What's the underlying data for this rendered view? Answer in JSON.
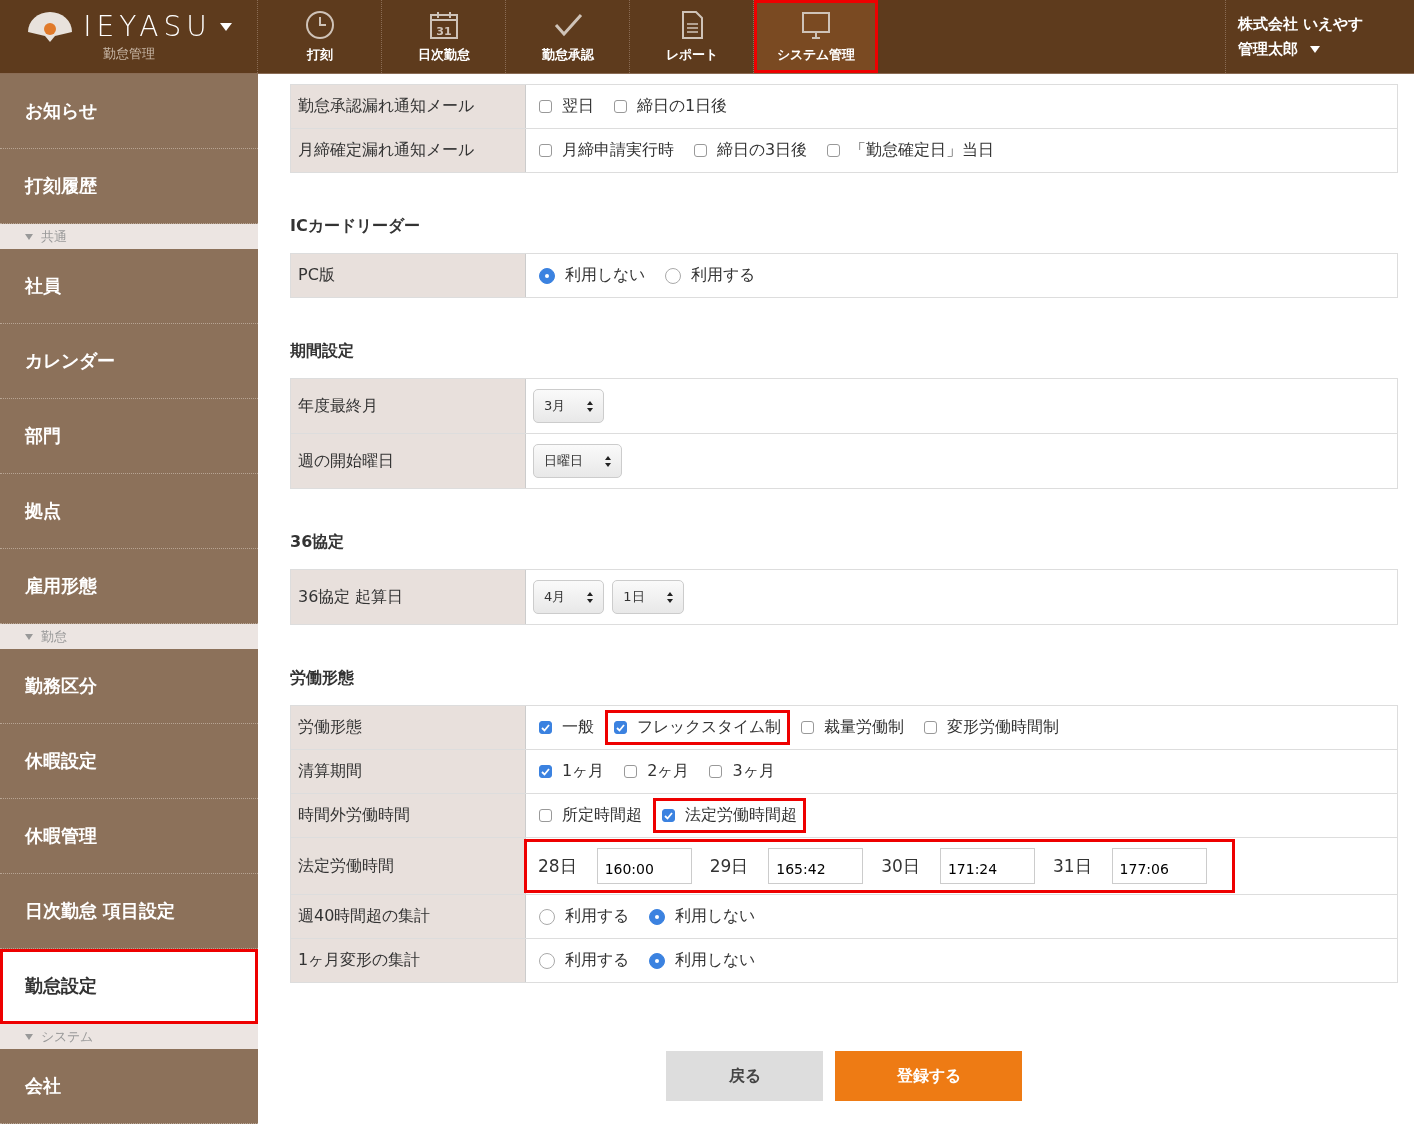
{
  "header": {
    "brand": "IEYASU",
    "subtitle": "勤怠管理",
    "nav": [
      {
        "label": "打刻",
        "kind": "clock",
        "selected": false,
        "highlighted": false
      },
      {
        "label": "日次勤怠",
        "kind": "calendar",
        "icon_text": "31",
        "selected": false,
        "highlighted": false
      },
      {
        "label": "勤怠承認",
        "kind": "check",
        "selected": false,
        "highlighted": false
      },
      {
        "label": "レポート",
        "kind": "document",
        "selected": false,
        "highlighted": false
      },
      {
        "label": "システム管理",
        "kind": "monitor",
        "selected": true,
        "highlighted": true
      }
    ],
    "user": {
      "company": "株式会社 いえやす",
      "name": "管理太郎"
    }
  },
  "sidebar": {
    "items": [
      {
        "kind": "item",
        "label": "お知らせ",
        "selected": false,
        "highlighted": false
      },
      {
        "kind": "item",
        "label": "打刻履歴",
        "selected": false,
        "highlighted": false
      },
      {
        "kind": "section",
        "label": "共通"
      },
      {
        "kind": "item",
        "label": "社員",
        "selected": false,
        "highlighted": false
      },
      {
        "kind": "item",
        "label": "カレンダー",
        "selected": false,
        "highlighted": false
      },
      {
        "kind": "item",
        "label": "部門",
        "selected": false,
        "highlighted": false
      },
      {
        "kind": "item",
        "label": "拠点",
        "selected": false,
        "highlighted": false
      },
      {
        "kind": "item",
        "label": "雇用形態",
        "selected": false,
        "highlighted": false
      },
      {
        "kind": "section",
        "label": "勤怠"
      },
      {
        "kind": "item",
        "label": "勤務区分",
        "selected": false,
        "highlighted": false
      },
      {
        "kind": "item",
        "label": "休暇設定",
        "selected": false,
        "highlighted": false
      },
      {
        "kind": "item",
        "label": "休暇管理",
        "selected": false,
        "highlighted": false
      },
      {
        "kind": "item",
        "label": "日次勤怠 項目設定",
        "selected": false,
        "highlighted": false
      },
      {
        "kind": "item",
        "label": "勤怠設定",
        "selected": true,
        "highlighted": true
      },
      {
        "kind": "section",
        "label": "システム"
      },
      {
        "kind": "item",
        "label": "会社",
        "selected": false,
        "highlighted": false
      }
    ]
  },
  "sections": [
    {
      "rows": [
        {
          "label": "勤怠承認漏れ通知メール",
          "kind": "checkboxes",
          "options": [
            {
              "label": "翌日",
              "checked": false,
              "highlighted": false
            },
            {
              "label": "締日の1日後",
              "checked": false,
              "highlighted": false
            }
          ]
        },
        {
          "label": "月締確定漏れ通知メール",
          "kind": "checkboxes",
          "options": [
            {
              "label": "月締申請実行時",
              "checked": false,
              "highlighted": false
            },
            {
              "label": "締日の3日後",
              "checked": false,
              "highlighted": false
            },
            {
              "label": "「勤怠確定日」当日",
              "checked": false,
              "highlighted": false
            }
          ]
        }
      ]
    },
    {
      "title": "ICカードリーダー",
      "rows": [
        {
          "label": "PC版",
          "kind": "radios",
          "options": [
            {
              "label": "利用しない",
              "selected": true
            },
            {
              "label": "利用する",
              "selected": false
            }
          ]
        }
      ]
    },
    {
      "title": "期間設定",
      "rows": [
        {
          "label": "年度最終月",
          "kind": "selects",
          "selects": [
            "3月"
          ]
        },
        {
          "label": "週の開始曜日",
          "kind": "selects",
          "selects": [
            "日曜日"
          ]
        }
      ]
    },
    {
      "title": "36協定",
      "rows": [
        {
          "label": "36協定 起算日",
          "kind": "selects",
          "selects": [
            "4月",
            "1日"
          ]
        }
      ]
    },
    {
      "title": "労働形態",
      "rows": [
        {
          "label": "労働形態",
          "kind": "checkboxes",
          "options": [
            {
              "label": "一般",
              "checked": true,
              "highlighted": false
            },
            {
              "label": "フレックスタイム制",
              "checked": true,
              "highlighted": true
            },
            {
              "label": "裁量労働制",
              "checked": false,
              "highlighted": false
            },
            {
              "label": "変形労働時間制",
              "checked": false,
              "highlighted": false
            }
          ]
        },
        {
          "label": "清算期間",
          "kind": "checkboxes",
          "options": [
            {
              "label": "1ヶ月",
              "checked": true,
              "highlighted": false
            },
            {
              "label": "2ヶ月",
              "checked": false,
              "highlighted": false
            },
            {
              "label": "3ヶ月",
              "checked": false,
              "highlighted": false
            }
          ]
        },
        {
          "label": "時間外労働時間",
          "kind": "checkboxes",
          "options": [
            {
              "label": "所定時間超",
              "checked": false,
              "highlighted": false
            },
            {
              "label": "法定労働時間超",
              "checked": true,
              "highlighted": true
            }
          ]
        },
        {
          "label": "法定労働時間",
          "kind": "hours",
          "highlighted": true,
          "entries": [
            {
              "day": "28日",
              "value": "160:00"
            },
            {
              "day": "29日",
              "value": "165:42"
            },
            {
              "day": "30日",
              "value": "171:24"
            },
            {
              "day": "31日",
              "value": "177:06"
            }
          ]
        },
        {
          "label": "週40時間超の集計",
          "kind": "radios",
          "options": [
            {
              "label": "利用する",
              "selected": false
            },
            {
              "label": "利用しない",
              "selected": true
            }
          ]
        },
        {
          "label": "1ヶ月変形の集計",
          "kind": "radios",
          "options": [
            {
              "label": "利用する",
              "selected": false
            },
            {
              "label": "利用しない",
              "selected": true
            }
          ]
        }
      ]
    }
  ],
  "buttons": [
    {
      "label": "戻る",
      "kind": "secondary"
    },
    {
      "label": "登録する",
      "kind": "primary"
    }
  ]
}
